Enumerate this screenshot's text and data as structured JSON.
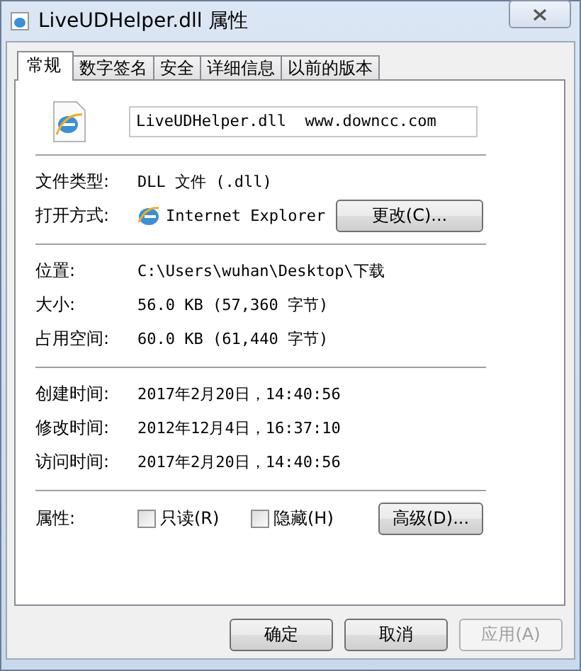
{
  "window": {
    "title": "LiveUDHelper.dll 属性"
  },
  "tabs": [
    {
      "label": "常规",
      "selected": true
    },
    {
      "label": "数字签名",
      "selected": false
    },
    {
      "label": "安全",
      "selected": false
    },
    {
      "label": "详细信息",
      "selected": false
    },
    {
      "label": "以前的版本",
      "selected": false
    }
  ],
  "file_name": "LiveUDHelper.dll  www.downcc.com",
  "sections": [
    [
      {
        "kind": "text",
        "label": "文件类型:",
        "value": "DLL 文件 (.dll)"
      },
      {
        "kind": "app",
        "label": "打开方式:",
        "value": "Internet Explorer",
        "button": "更改(C)..."
      }
    ],
    [
      {
        "kind": "text",
        "label": "位置:",
        "value": "C:\\Users\\wuhan\\Desktop\\下载"
      },
      {
        "kind": "text",
        "label": "大小:",
        "value": "56.0 KB (57,360 字节)"
      },
      {
        "kind": "text",
        "label": "占用空间:",
        "value": "60.0 KB (61,440 字节)"
      }
    ],
    [
      {
        "kind": "text",
        "label": "创建时间:",
        "value": "2017年2月20日，14:40:56"
      },
      {
        "kind": "text",
        "label": "修改时间:",
        "value": "2012年12月4日，16:37:10"
      },
      {
        "kind": "text",
        "label": "访问时间:",
        "value": "2017年2月20日，14:40:56"
      }
    ]
  ],
  "attributes": {
    "label": "属性:",
    "checkboxes": [
      {
        "label": "只读(R)",
        "checked": false
      },
      {
        "label": "隐藏(H)",
        "checked": false
      }
    ],
    "button": "高级(D)..."
  },
  "buttons": [
    {
      "label": "确定",
      "disabled": false
    },
    {
      "label": "取消",
      "disabled": false
    },
    {
      "label": "应用(A)",
      "disabled": true
    }
  ]
}
